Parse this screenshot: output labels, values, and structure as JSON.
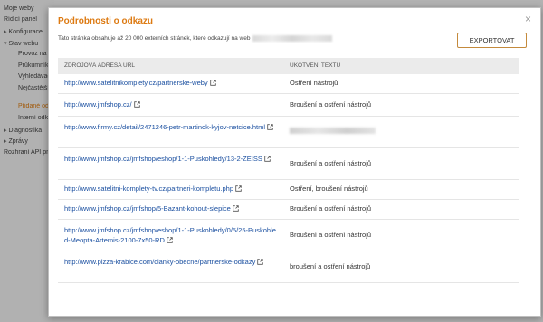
{
  "sidebar": {
    "items": [
      {
        "label": "Moje weby",
        "indent": 0,
        "arrow": ""
      },
      {
        "label": "Řídicí panel",
        "indent": 0,
        "arrow": ""
      },
      {
        "label": "Konfigurace",
        "indent": 0,
        "arrow": "▸"
      },
      {
        "label": "Stav webu",
        "indent": 0,
        "arrow": "▾"
      },
      {
        "label": "Provoz na webu",
        "indent": 1,
        "arrow": ""
      },
      {
        "label": "Průkumník Google",
        "indent": 1,
        "arrow": ""
      },
      {
        "label": "Vyhledávací dotazy",
        "indent": 1,
        "arrow": ""
      },
      {
        "label": "Nejčastější",
        "indent": 1,
        "arrow": ""
      },
      {
        "label": "Přidané odkazy",
        "indent": 1,
        "arrow": ""
      },
      {
        "label": "Interní odkazy",
        "indent": 1,
        "arrow": ""
      },
      {
        "label": "Diagnostika",
        "indent": 0,
        "arrow": "▸"
      },
      {
        "label": "Zprávy",
        "indent": 0,
        "arrow": "▸"
      },
      {
        "label": "Rozhraní API pro",
        "indent": 0,
        "arrow": ""
      }
    ]
  },
  "dialog": {
    "title": "Podrobnosti o odkazu",
    "close_symbol": "×",
    "description": "Tato stránka obsahuje až 20 000 externích stránek, které odkazují na web",
    "export_label": "EXPORTOVAT",
    "columns": {
      "source": "ZDROJOVÁ ADRESA URL",
      "anchor": "UKOTVENÍ TEXTU"
    },
    "rows": [
      {
        "url": "http://www.satelitnikomplety.cz/partnerske-weby",
        "anchor": "Ostření nástrojů",
        "anchor_hidden": false
      },
      {
        "url": "http://www.jmfshop.cz/",
        "anchor": "Broušení a ostření nástrojů",
        "anchor_hidden": false
      },
      {
        "url": "http://www.firmy.cz/detail/2471246-petr-martinok-kyjov-netcice.html",
        "anchor": "",
        "anchor_hidden": true
      },
      {
        "url": "http://www.jmfshop.cz/jmfshop/eshop/1-1-Puskohledy/13-2-ZEISS",
        "anchor": "Broušení a ostření nástrojů",
        "anchor_hidden": false
      },
      {
        "url": "http://www.satelitni-komplety-tv.cz/partneri-kompletu.php",
        "anchor": "Ostření, broušení nástrojů",
        "anchor_hidden": false
      },
      {
        "url": "http://www.jmfshop.cz/jmfshop/5-Bazant-kohout-slepice",
        "anchor": "Broušení a ostření nástrojů",
        "anchor_hidden": false
      },
      {
        "url": "http://www.jmfshop.cz/jmfshop/eshop/1-1-Puskohledy/0/5/25-Puskohled-Meopta-Artemis-2100-7x50-RD",
        "anchor": "Broušení a ostření nástrojů",
        "anchor_hidden": false
      },
      {
        "url": "http://www.pizza-krabice.com/clanky-obecne/partnerske-odkazy",
        "anchor": "broušení a ostření nástrojů",
        "anchor_hidden": false
      }
    ]
  },
  "colors": {
    "title": "#dd7a12",
    "link": "#1a4fa0",
    "export_border": "#c48a3c",
    "active_sidebar": "#e07d10"
  },
  "icons": {
    "external_link": "external-link-icon",
    "close": "close-icon"
  }
}
